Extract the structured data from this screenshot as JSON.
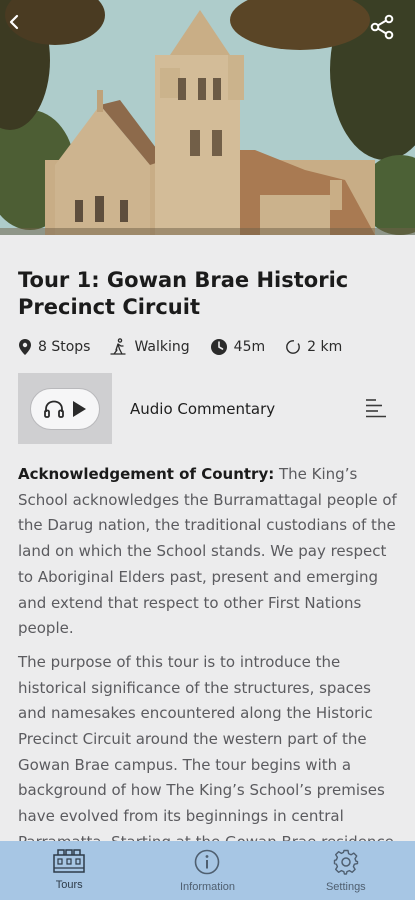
{
  "hero": {
    "alt_icon_back": "chevron-left-icon",
    "alt_icon_share": "share-icon"
  },
  "tour": {
    "title": "Tour 1: Gowan Brae Historic Precinct Circuit",
    "meta": {
      "stops": "8 Stops",
      "mode": "Walking",
      "duration": "45m",
      "distance": "2 km"
    }
  },
  "audio": {
    "label": "Audio Commentary"
  },
  "body": {
    "ack_heading": "Acknowledgement of Country:",
    "ack_text": " The King’s School acknowledges the Burramattagal people of the Darug nation, the traditional custodians of the land on which the School stands. We pay respect to Aboriginal Elders past, present and emerging and extend that respect to other First Nations people.",
    "intro": "The purpose of this tour is to introduce the historical significance of the structures, spaces and namesakes encountered along the Historic Precinct Circuit around the western part of the Gowan Brae campus. The tour begins with a background of how The King’s School’s premises have evolved from its beginnings in central Parramatta. Starting at the Gowan Brae residence"
  },
  "nav": {
    "tours": "Tours",
    "information": "Information",
    "settings": "Settings"
  },
  "colors": {
    "nav_bg": "#a7c6e4",
    "page_bg": "#ececed",
    "text_muted": "#5b5b5f"
  }
}
